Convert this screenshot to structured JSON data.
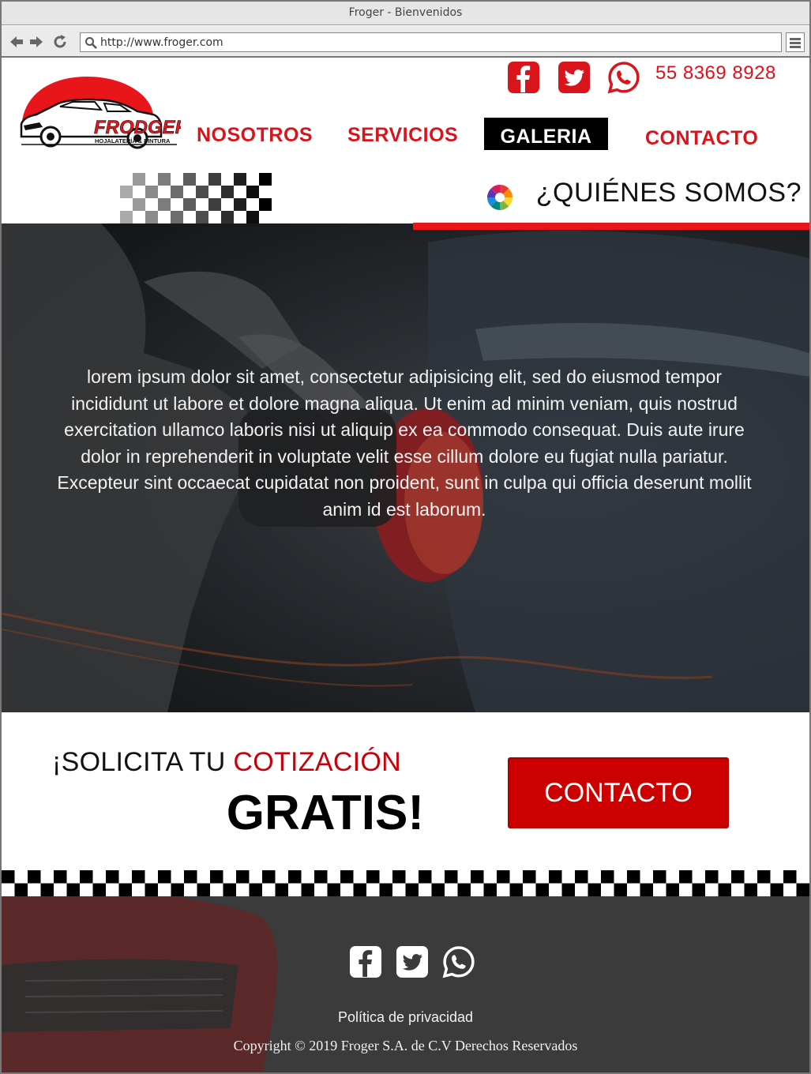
{
  "browser": {
    "window_title": "Froger - Bienvenidos",
    "url": "http://www.froger.com",
    "icons": [
      "back-arrow-icon",
      "forward-arrow-icon",
      "reload-icon",
      "search-icon",
      "hamburger-menu-icon"
    ]
  },
  "header": {
    "logo": {
      "brand": "FRODGER",
      "tagline": "HOJALATERÍA & PINTURA"
    },
    "social_icons": [
      "facebook-icon",
      "twitter-icon",
      "whatsapp-icon"
    ],
    "phone": "55 8369 8928",
    "nav": {
      "nosotros": "NOSOTROS",
      "servicios": "SERVICIOS",
      "galeria": "GALERIA",
      "contacto": "CONTACTO"
    },
    "active_nav": "GALERIA",
    "accent_color": "#d9141b"
  },
  "hero": {
    "title": "¿QUIÉNES SOMOS?",
    "icon": "color-wheel-icon",
    "body": "lorem ipsum dolor sit amet, consectetur adipisicing elit, sed do eiusmod tempor incididunt ut labore et dolore magna aliqua. Ut enim ad minim veniam, quis nostrud exercitation ullamco laboris nisi ut aliquip ex ea commodo consequat. Duis aute irure dolor in reprehenderit in voluptate velit esse cillum dolore eu fugiat nulla pariatur. Excepteur sint occaecat cupidatat non proident, sunt in culpa qui officia deserunt mollit anim id est laborum."
  },
  "cta": {
    "line1_prefix": "¡SOLICITA TU ",
    "line1_accent": "COTIZACIÓN",
    "line2": "GRATIS!",
    "button_label": "CONTACTO",
    "button_color": "#cc0000"
  },
  "footer": {
    "social_icons": [
      "facebook-icon",
      "twitter-icon",
      "whatsapp-icon"
    ],
    "privacy": "Política de privacidad",
    "copyright": "Copyright © 2019 Froger S.A. de C.V Derechos Reservados"
  }
}
